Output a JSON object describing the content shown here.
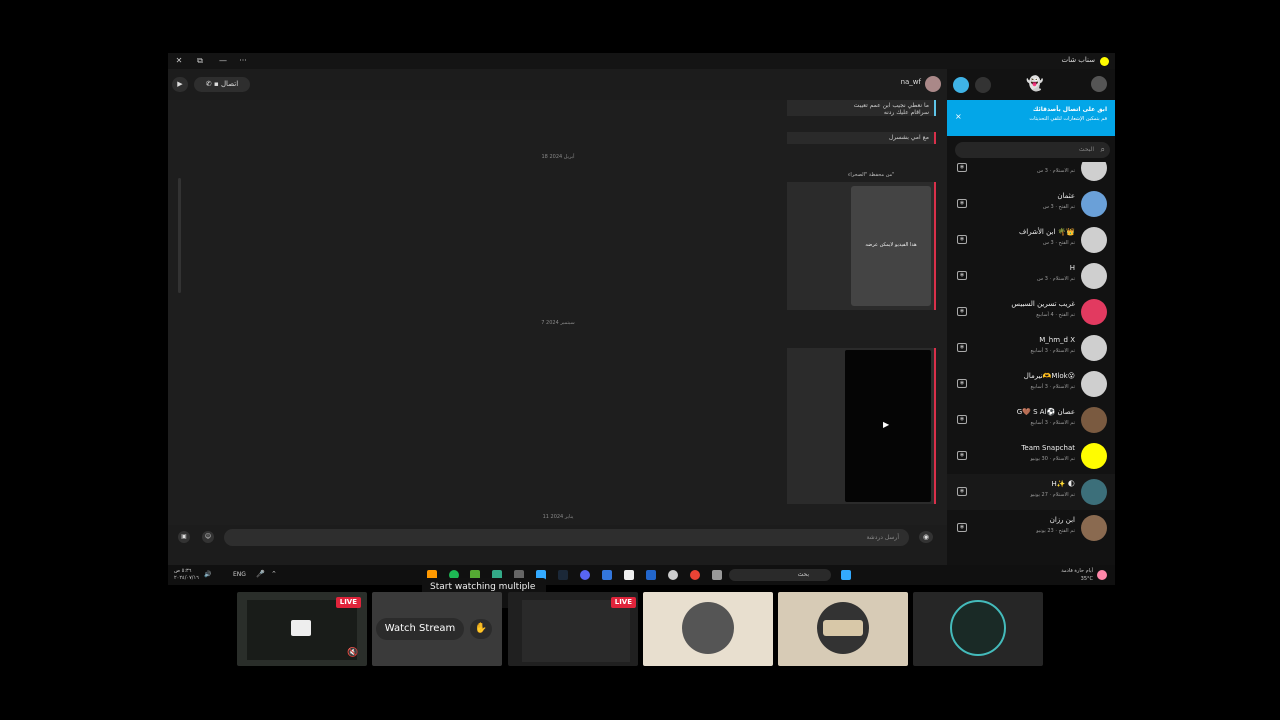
{
  "window": {
    "app_title": "سناب شات",
    "controls": {
      "close": "✕",
      "restore": "⧉",
      "minimize": "—",
      "more": "···"
    }
  },
  "chat_header": {
    "username": "na_wf",
    "call_label": "اتصال"
  },
  "chat": {
    "messages": [
      {
        "text_line1": "ما نعطي نجيب ابن عمم تعيبت",
        "text_line2": "سراقام عليك ردنه"
      },
      {
        "text": "مع امي بشسرل"
      }
    ],
    "dates": [
      "18 أبريل 2024",
      "7 سبتمبر 2024",
      "11 يناير 2024"
    ],
    "snap_sender": "من محفظة \"الصحراء\"",
    "snap_caption": "هذا الفيديو لايمكن عرضه",
    "input_placeholder": "أرسل دردشة"
  },
  "sidebar": {
    "banner_title": "ابق على اتصال بأصدقائك",
    "banner_text": "قم بتمكين الإشعارات لتلقي التحديثات",
    "banner_close": "×",
    "search_placeholder": "البحث",
    "contacts": [
      {
        "name": "",
        "status": "تم الاستلام · 3 س"
      },
      {
        "name": "عثمان",
        "status": "تم الفتح · 3 س"
      },
      {
        "name": "ابن الأشراف 🌴👑",
        "status": "تم الفتح · 3 س"
      },
      {
        "name": "H",
        "status": "تم الاستلام · 3 س"
      },
      {
        "name": "غريب تسرين السبيس",
        "status": "تم الفتح · 4 أسابيع"
      },
      {
        "name": "M_hm_d X",
        "status": "تم الاستلام · 3 أسابيع"
      },
      {
        "name": "نيرمال🫶Mlok😮",
        "status": "تم الاستلام · 3 أسابيع"
      },
      {
        "name": "G🤎 S Al⚽ عصان",
        "status": "تم الاستلام · 3 أسابيع"
      },
      {
        "name": "Team Snapchat",
        "status": "تم الاستلام · 30 يونيو"
      },
      {
        "name": "H✨ 🌓",
        "status": "تم الاستلام · 27 يونيو"
      },
      {
        "name": "ابن رزان",
        "status": "تم الفتح · 23 يونيو"
      }
    ]
  },
  "taskbar": {
    "weather_temp": "35°C",
    "weather_text": "أيام حارة قادمة",
    "search_label": "بحث",
    "language": "ENG",
    "time": "٥:٣٦ ص",
    "date": "٢٠٢٤/٠٧/١٦"
  },
  "streams": {
    "live_label": "LIVE",
    "watch_label": "Watch Stream",
    "tooltip": "Start watching multiple streams"
  },
  "colors": {
    "snap_yellow": "#fffc00",
    "banner_blue": "#03a6e8",
    "live_red": "#e0243b",
    "accent_red": "#d9304a"
  }
}
